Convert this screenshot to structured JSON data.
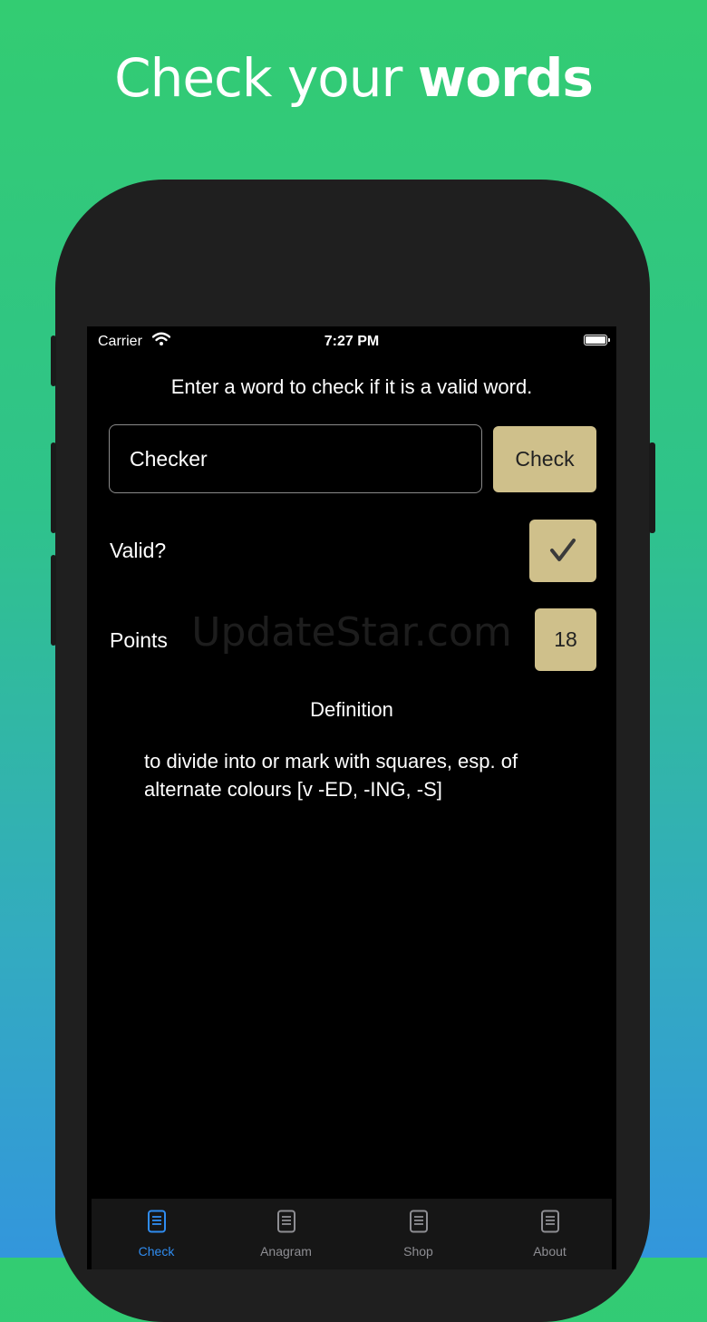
{
  "headline": {
    "regular": "Check your ",
    "bold": "words"
  },
  "status_bar": {
    "carrier": "Carrier",
    "time": "7:27 PM"
  },
  "instruction": "Enter a word to check if it is a valid word.",
  "word_input": {
    "value": "Checker"
  },
  "check_button": {
    "label": "Check"
  },
  "valid": {
    "label": "Valid?",
    "result_icon": "checkmark-icon"
  },
  "points": {
    "label": "Points",
    "value": "18"
  },
  "watermark": "UpdateStar.com",
  "definition": {
    "title": "Definition",
    "text": "to divide into or mark with squares, esp. of alternate colours [v -ED, -ING, -S]"
  },
  "tabs": [
    {
      "label": "Check",
      "icon": "document-icon",
      "active": true
    },
    {
      "label": "Anagram",
      "icon": "document-icon",
      "active": false
    },
    {
      "label": "Shop",
      "icon": "document-icon",
      "active": false
    },
    {
      "label": "About",
      "icon": "document-icon",
      "active": false
    }
  ],
  "colors": {
    "accent_tan": "#cfc08b",
    "tab_active": "#2f8cf0",
    "tab_inactive": "#8e8e93"
  }
}
